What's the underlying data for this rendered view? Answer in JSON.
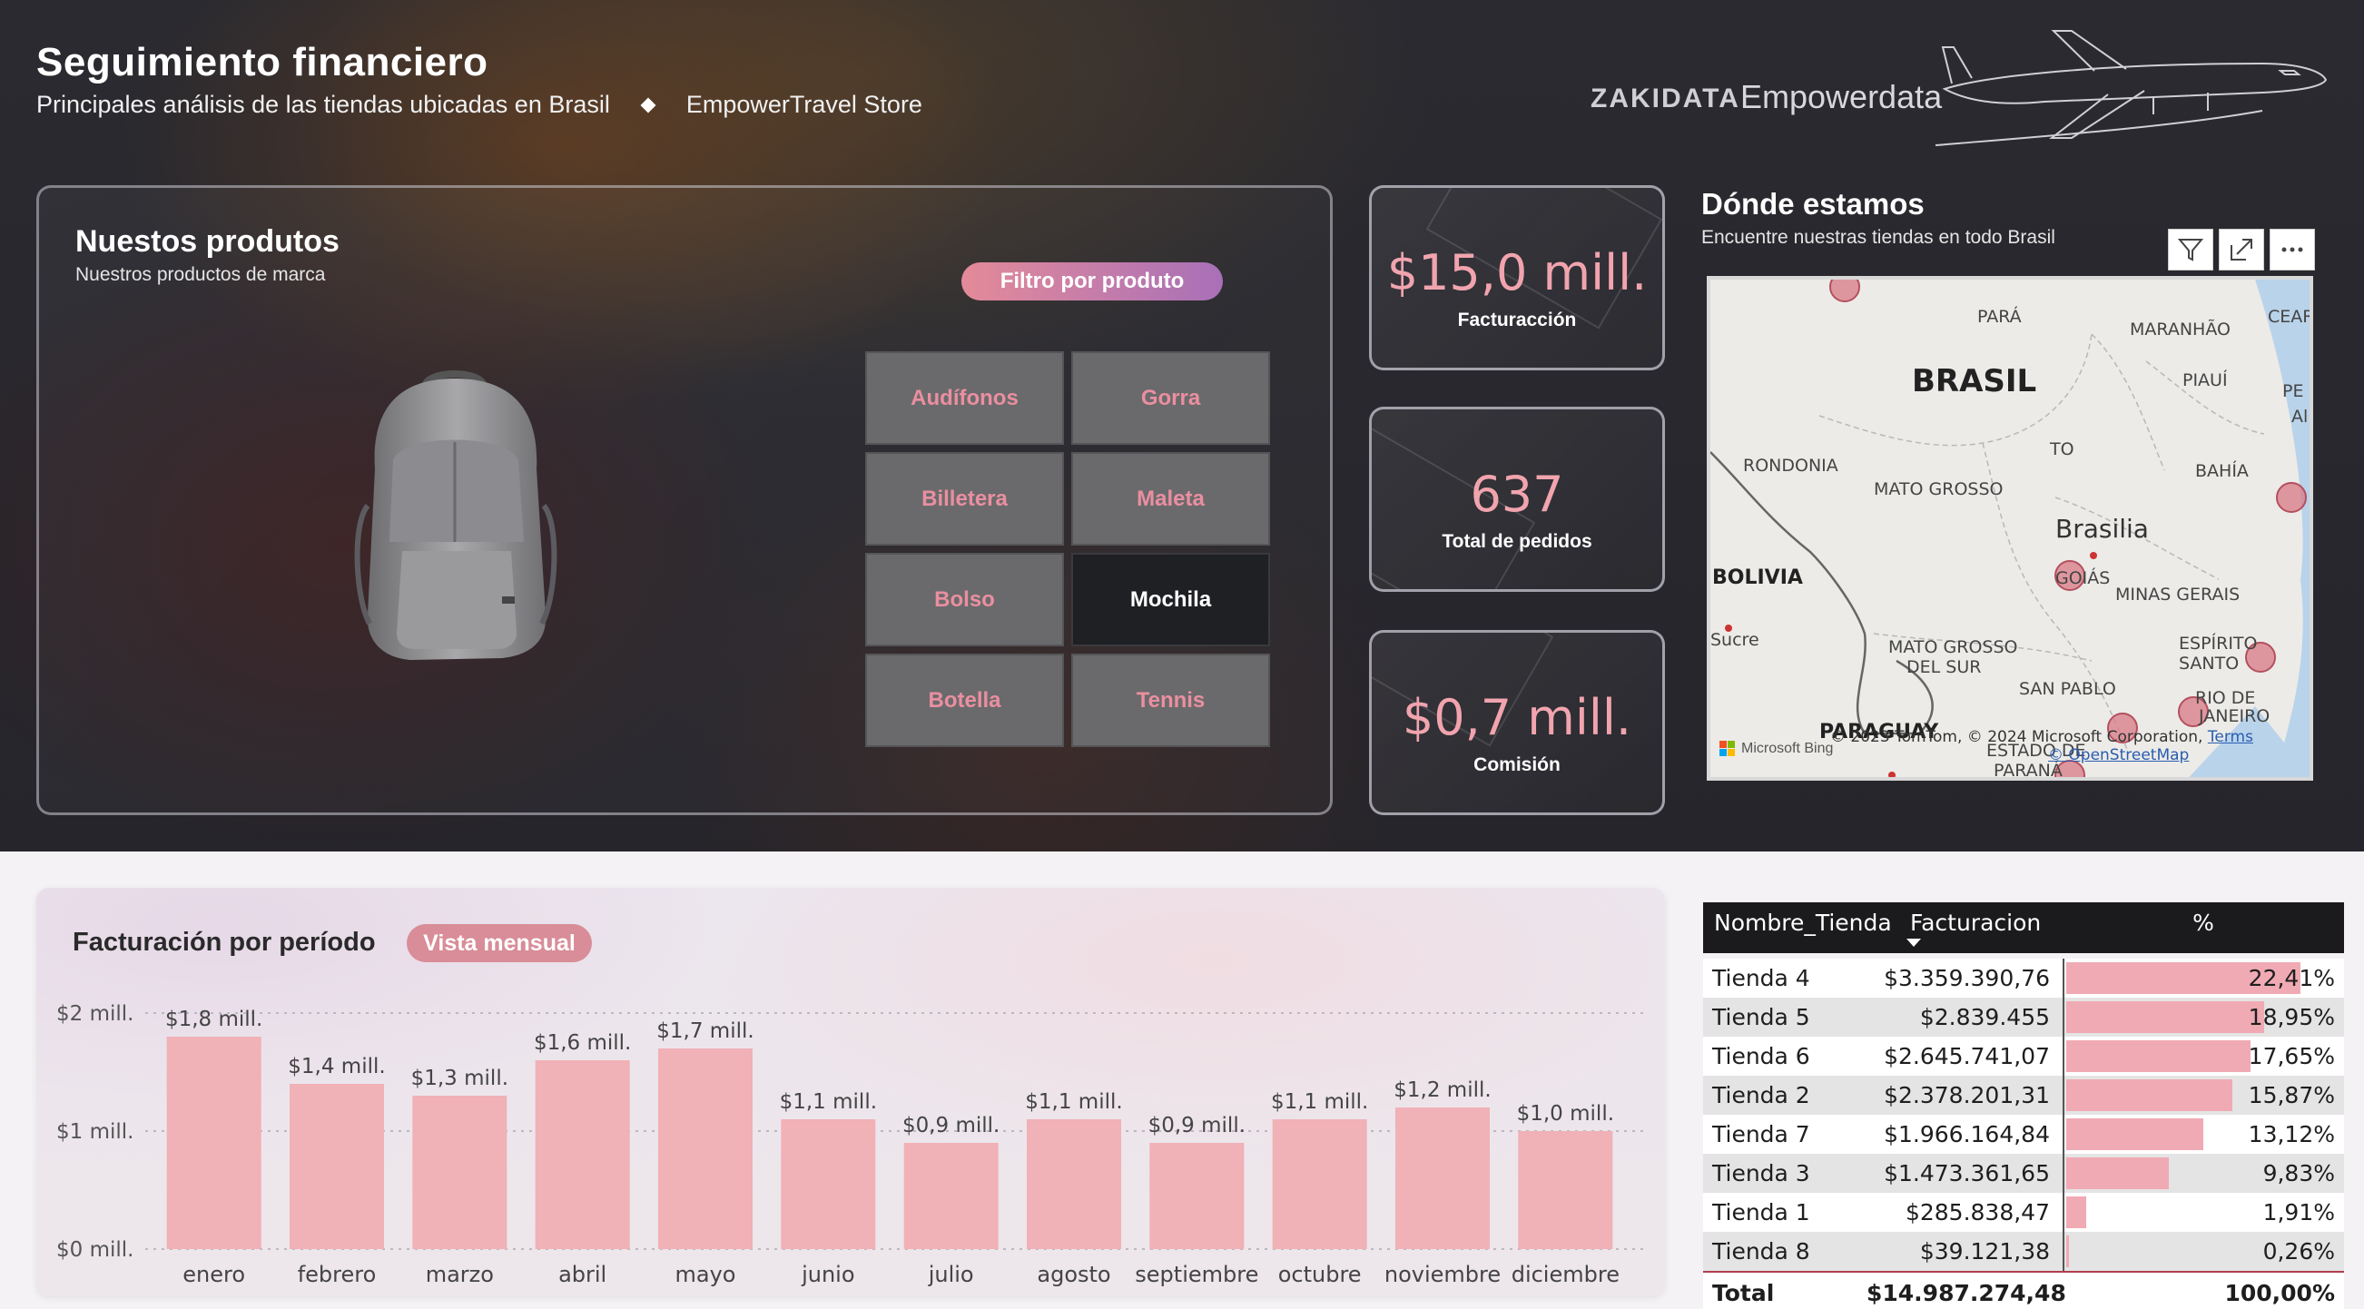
{
  "header": {
    "title": "Seguimiento financiero",
    "subtitle": "Principales análisis de las tiendas ubicadas en Brasil",
    "store": "EmpowerTravel Store"
  },
  "brand": {
    "company": "ZAKIDATA",
    "product": "Empowerdata"
  },
  "products": {
    "title": "Nuestos produtos",
    "subtitle": "Nuestros productos de marca",
    "filter_label": "Filtro por produto",
    "selected": "Mochila",
    "options": [
      "Audífonos",
      "Gorra",
      "Billetera",
      "Maleta",
      "Bolso",
      "Mochila",
      "Botella",
      "Tennis"
    ]
  },
  "kpis": [
    {
      "value": "$15,0 mill.",
      "label": "Facturacción"
    },
    {
      "value": "637",
      "label": "Total de pedidos"
    },
    {
      "value": "$0,7 mill.",
      "label": "Comisión"
    }
  ],
  "map": {
    "title": "Dónde estamos",
    "subtitle": "Encuentre nuestras tiendas en todo Brasil",
    "labels": {
      "country": "BRASIL",
      "capital": "Brasilia",
      "para": "PARÁ",
      "maranhao": "MARANHÃO",
      "ceara": "CEARÁ",
      "piaui": "PIAUÍ",
      "pe": "PE",
      "al": "Al",
      "to": "TO",
      "rondonia": "RONDONIA",
      "mato_grosso": "MATO GROSSO",
      "bahia": "BAHÍA",
      "bolivia": "BOLIVIA",
      "goias": "GOIÁS",
      "minas": "MINAS GERAIS",
      "sucre": "Sucre",
      "mgs": "MATO GROSSO",
      "mgs2": "DEL SUR",
      "espirito": "ESPÍRITO SANTO",
      "sao_pablo": "SAN PABLO",
      "rio": "RIO DE",
      "janeiro": "JANEIRO",
      "paraguay": "PARAGUAY",
      "estado": "ESTADO DE",
      "parana": "PARANÁ"
    },
    "attribution": "© 2023 TomTom, © 2024 Microsoft Corporation,",
    "terms": "Terms",
    "osm": "© OpenStreetMap",
    "bing": "Microsoft Bing"
  },
  "chart": {
    "title": "Facturación por período",
    "view_label": "Vista mensual"
  },
  "chart_data": {
    "type": "bar",
    "categories": [
      "enero",
      "febrero",
      "marzo",
      "abril",
      "mayo",
      "junio",
      "julio",
      "agosto",
      "septiembre",
      "octubre",
      "noviembre",
      "diciembre"
    ],
    "values": [
      1.8,
      1.4,
      1.3,
      1.6,
      1.7,
      1.1,
      0.9,
      1.1,
      0.9,
      1.1,
      1.2,
      1.0
    ],
    "data_labels": [
      "$1,8 mill.",
      "$1,4 mill.",
      "$1,3 mill.",
      "$1,6 mill.",
      "$1,7 mill.",
      "$1,1 mill.",
      "$0,9 mill.",
      "$1,1 mill.",
      "$0,9 mill.",
      "$1,1 mill.",
      "$1,2 mill.",
      "$1,0 mill."
    ],
    "y_ticks": [
      "$0 mill.",
      "$1 mill.",
      "$2 mill."
    ],
    "ylim": [
      0,
      2
    ],
    "bar_color": "#f0b1b7",
    "grid": true
  },
  "table": {
    "headers": [
      "Nombre_Tienda",
      "Facturacion",
      "%"
    ],
    "rows": [
      {
        "name": "Tienda 4",
        "value": "$3.359.390,76",
        "pct": "22,41%",
        "share": 22.41
      },
      {
        "name": "Tienda 5",
        "value": "$2.839.455",
        "pct": "18,95%",
        "share": 18.95
      },
      {
        "name": "Tienda 6",
        "value": "$2.645.741,07",
        "pct": "17,65%",
        "share": 17.65
      },
      {
        "name": "Tienda 2",
        "value": "$2.378.201,31",
        "pct": "15,87%",
        "share": 15.87
      },
      {
        "name": "Tienda 7",
        "value": "$1.966.164,84",
        "pct": "13,12%",
        "share": 13.12
      },
      {
        "name": "Tienda 3",
        "value": "$1.473.361,65",
        "pct": "9,83%",
        "share": 9.83
      },
      {
        "name": "Tienda 1",
        "value": "$285.838,47",
        "pct": "1,91%",
        "share": 1.91
      },
      {
        "name": "Tienda 8",
        "value": "$39.121,38",
        "pct": "0,26%",
        "share": 0.26
      }
    ],
    "total": {
      "name": "Total",
      "value": "$14.987.274,48",
      "pct": "100,00%"
    }
  }
}
